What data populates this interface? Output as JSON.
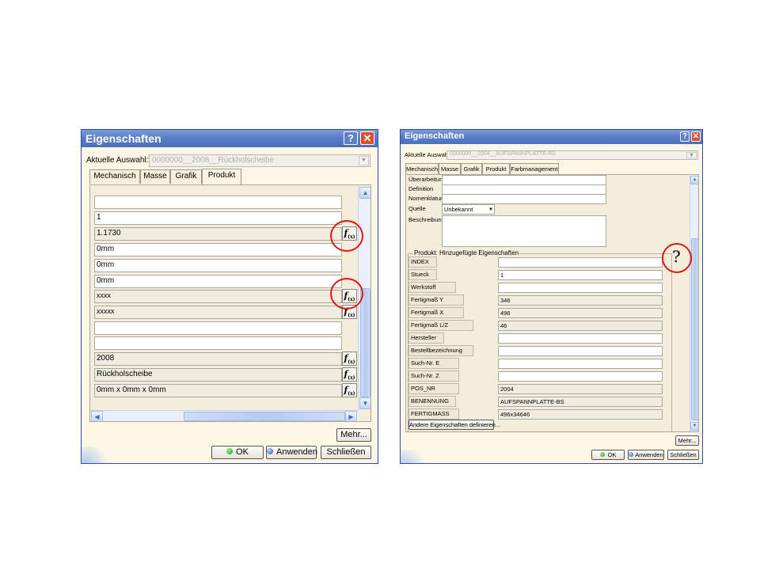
{
  "left_dialog": {
    "title": "Eigenschaften",
    "help_glyph": "?",
    "close_glyph": "✕",
    "selection_label": "Aktuelle Auswahl:",
    "selection_value": "0000000__2008__Rückholscheibe",
    "tabs": [
      {
        "label": "Mechanisch"
      },
      {
        "label": "Masse"
      },
      {
        "label": "Grafik"
      },
      {
        "label": "Produkt"
      }
    ],
    "fields": [
      "",
      "1",
      "1.1730",
      "0mm",
      "0mm",
      "0mm",
      "xxxx",
      "xxxxx",
      "",
      "",
      "2008",
      "Rückholscheibe",
      "0mm x 0mm x 0mm"
    ],
    "more_button": "Mehr...",
    "ok_button": "OK",
    "apply_button": "Anwenden",
    "close_button": "Schließen",
    "fx_icon": "f(x)"
  },
  "right_dialog": {
    "title": "Eigenschaften",
    "help_glyph": "?",
    "close_glyph": "✕",
    "selection_label": "Aktuelle Auswahl:",
    "selection_value": "0000000__2004__AUFSPANNPLATTE-BS",
    "tabs": [
      {
        "label": "Mechanisch"
      },
      {
        "label": "Masse"
      },
      {
        "label": "Grafik"
      },
      {
        "label": "Produkt"
      },
      {
        "label": "Farbmanagement"
      }
    ],
    "top_rows": [
      {
        "label": "Überarbeitung"
      },
      {
        "label": "Definition"
      },
      {
        "label": "Nomenklatur"
      },
      {
        "label": "Quelle",
        "value": "Unbekannt"
      },
      {
        "label": "Beschreibung"
      }
    ],
    "group_label": "Produkt: Hinzugefügte Eigenschaften",
    "properties": [
      {
        "name": "INDEX",
        "value": ""
      },
      {
        "name": "Stueck",
        "value": "1"
      },
      {
        "name": "Werkstoff",
        "value": ""
      },
      {
        "name": "Fertigmaß Y",
        "value": "346"
      },
      {
        "name": "Fertigmaß X",
        "value": "496"
      },
      {
        "name": "Fertigmaß L/Z",
        "value": "46"
      },
      {
        "name": "Hersteller",
        "value": ""
      },
      {
        "name": "Bestellbezeichnung",
        "value": ""
      },
      {
        "name": "Such-Nr. E",
        "value": ""
      },
      {
        "name": "Such-Nr. Z",
        "value": ""
      },
      {
        "name": "POS_NR",
        "value": "2004"
      },
      {
        "name": "BENENNUNG",
        "value": "AUFSPANNPLATTE-BS"
      },
      {
        "name": "FERTIGMASS",
        "value": "496x34646"
      }
    ],
    "define_button": "Andere Eigenschaften definieren...",
    "more_button": "Mehr...",
    "ok_button": "OK",
    "apply_button": "Anwenden",
    "close_button": "Schließen",
    "question_mark": "?"
  },
  "colors": {
    "annotation": "#e01616",
    "titlebar": "#5b7fc6",
    "dialog_bg": "#fdf6e4"
  }
}
